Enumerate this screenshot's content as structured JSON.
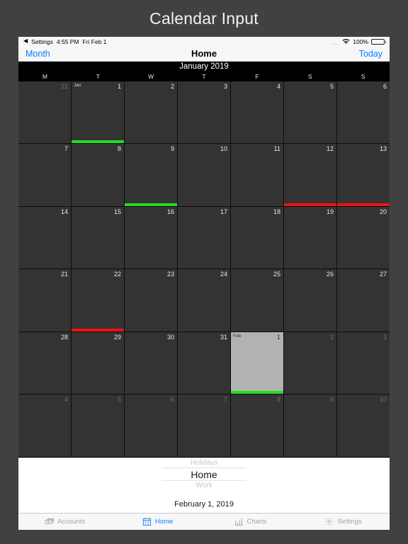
{
  "page": {
    "title": "Calendar Input"
  },
  "status_bar": {
    "back_label": "Settings",
    "back_arrow": "◀",
    "time": "4:55 PM",
    "date": "Fri Feb 1",
    "signal_dots": "....",
    "wifi_icon": "wifi-icon",
    "battery_percent": "100%",
    "battery_icon": "battery-icon"
  },
  "nav_bar": {
    "left_label": "Month",
    "title": "Home",
    "right_label": "Today"
  },
  "calendar": {
    "month_header": "January 2019",
    "weekday_headers": [
      "M",
      "T",
      "W",
      "T",
      "F",
      "S",
      "S"
    ],
    "colors": {
      "event_green": "#22dd22",
      "event_red": "#f21212",
      "selected_bg": "#b2b2b2",
      "cell_bg": "#333333"
    },
    "weeks": [
      [
        {
          "num": "31",
          "adjacent": true
        },
        {
          "num": "1",
          "month_tag": "Jan",
          "bar": "green"
        },
        {
          "num": "2"
        },
        {
          "num": "3"
        },
        {
          "num": "4"
        },
        {
          "num": "5"
        },
        {
          "num": "6"
        }
      ],
      [
        {
          "num": "7"
        },
        {
          "num": "8"
        },
        {
          "num": "9",
          "bar": "green"
        },
        {
          "num": "10"
        },
        {
          "num": "11"
        },
        {
          "num": "12",
          "bar": "red"
        },
        {
          "num": "13",
          "bar": "red"
        }
      ],
      [
        {
          "num": "14"
        },
        {
          "num": "15"
        },
        {
          "num": "16"
        },
        {
          "num": "17"
        },
        {
          "num": "18"
        },
        {
          "num": "19"
        },
        {
          "num": "20"
        }
      ],
      [
        {
          "num": "21"
        },
        {
          "num": "22"
        },
        {
          "num": "23"
        },
        {
          "num": "24"
        },
        {
          "num": "25"
        },
        {
          "num": "26"
        },
        {
          "num": "27"
        }
      ],
      [
        {
          "num": "28"
        },
        {
          "num": "29",
          "topbar": "red"
        },
        {
          "num": "30"
        },
        {
          "num": "31"
        },
        {
          "num": "1",
          "month_tag": "Feb",
          "selected": true,
          "bar": "green"
        },
        {
          "num": "2",
          "adjacent": true
        },
        {
          "num": "3",
          "adjacent": true
        }
      ],
      [
        {
          "num": "4",
          "adjacent": true
        },
        {
          "num": "5",
          "adjacent": true
        },
        {
          "num": "6",
          "adjacent": true
        },
        {
          "num": "7",
          "adjacent": true
        },
        {
          "num": "8",
          "adjacent": true
        },
        {
          "num": "9",
          "adjacent": true
        },
        {
          "num": "10",
          "adjacent": true
        }
      ]
    ]
  },
  "picker": {
    "above": "Holidays",
    "selected": "Home",
    "below": "Work",
    "date_label": "February 1, 2019"
  },
  "tab_bar": {
    "tabs": [
      {
        "label": "Accounts",
        "icon": "bills-icon",
        "active": false
      },
      {
        "label": "Home",
        "icon": "calendar-icon",
        "active": true
      },
      {
        "label": "Charts",
        "icon": "bar-chart-icon",
        "active": false
      },
      {
        "label": "Settings",
        "icon": "gear-icon",
        "active": false
      }
    ]
  }
}
